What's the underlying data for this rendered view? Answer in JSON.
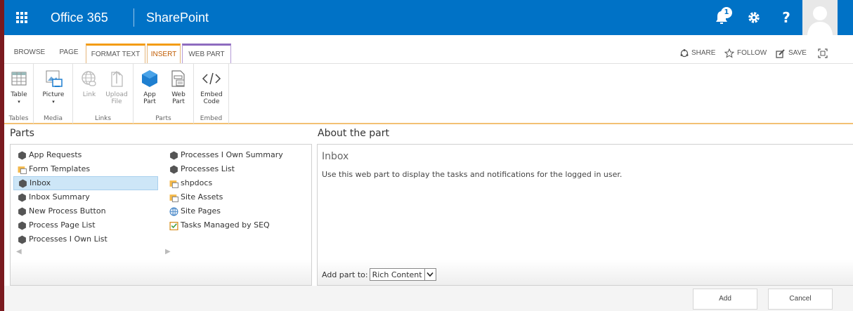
{
  "suitebar": {
    "brand": "Office 365",
    "app_name": "SharePoint",
    "notification_count": "1",
    "help_label": "?"
  },
  "ribbon": {
    "tabs": [
      "BROWSE",
      "PAGE",
      "FORMAT TEXT",
      "INSERT",
      "WEB PART"
    ],
    "actions": {
      "share": "SHARE",
      "follow": "FOLLOW",
      "save": "SAVE"
    },
    "groups": {
      "tables": {
        "label": "Tables",
        "table": "Table"
      },
      "media": {
        "label": "Media",
        "picture": "Picture"
      },
      "links": {
        "label": "Links",
        "link": "Link",
        "upload_line1": "Upload",
        "upload_line2": "File"
      },
      "parts": {
        "label": "Parts",
        "app_line1": "App",
        "app_line2": "Part",
        "web_line1": "Web",
        "web_line2": "Part"
      },
      "embed": {
        "label": "Embed",
        "line1": "Embed",
        "line2": "Code"
      }
    }
  },
  "parts": {
    "title": "Parts",
    "col1": [
      "App Requests",
      "Form Templates",
      "Inbox",
      "Inbox Summary",
      "New Process Button",
      "Process Page List",
      "Processes I Own List"
    ],
    "col2": [
      "Processes I Own Summary",
      "Processes List",
      "shpdocs",
      "Site Assets",
      "Site Pages",
      "Tasks Managed by SEQ"
    ]
  },
  "about": {
    "title": "About the part",
    "part_name": "Inbox",
    "description": "Use this web part to display the tasks and notifications for the logged in user.",
    "add_part_label": "Add part to:",
    "add_part_value": "Rich Content"
  },
  "footer": {
    "add": "Add",
    "cancel": "Cancel"
  },
  "colors": {
    "suite_blue": "#0072c6",
    "insert_orange": "#f39c12",
    "webpart_purple": "#8e6bbf",
    "selection": "#cde6f7"
  }
}
